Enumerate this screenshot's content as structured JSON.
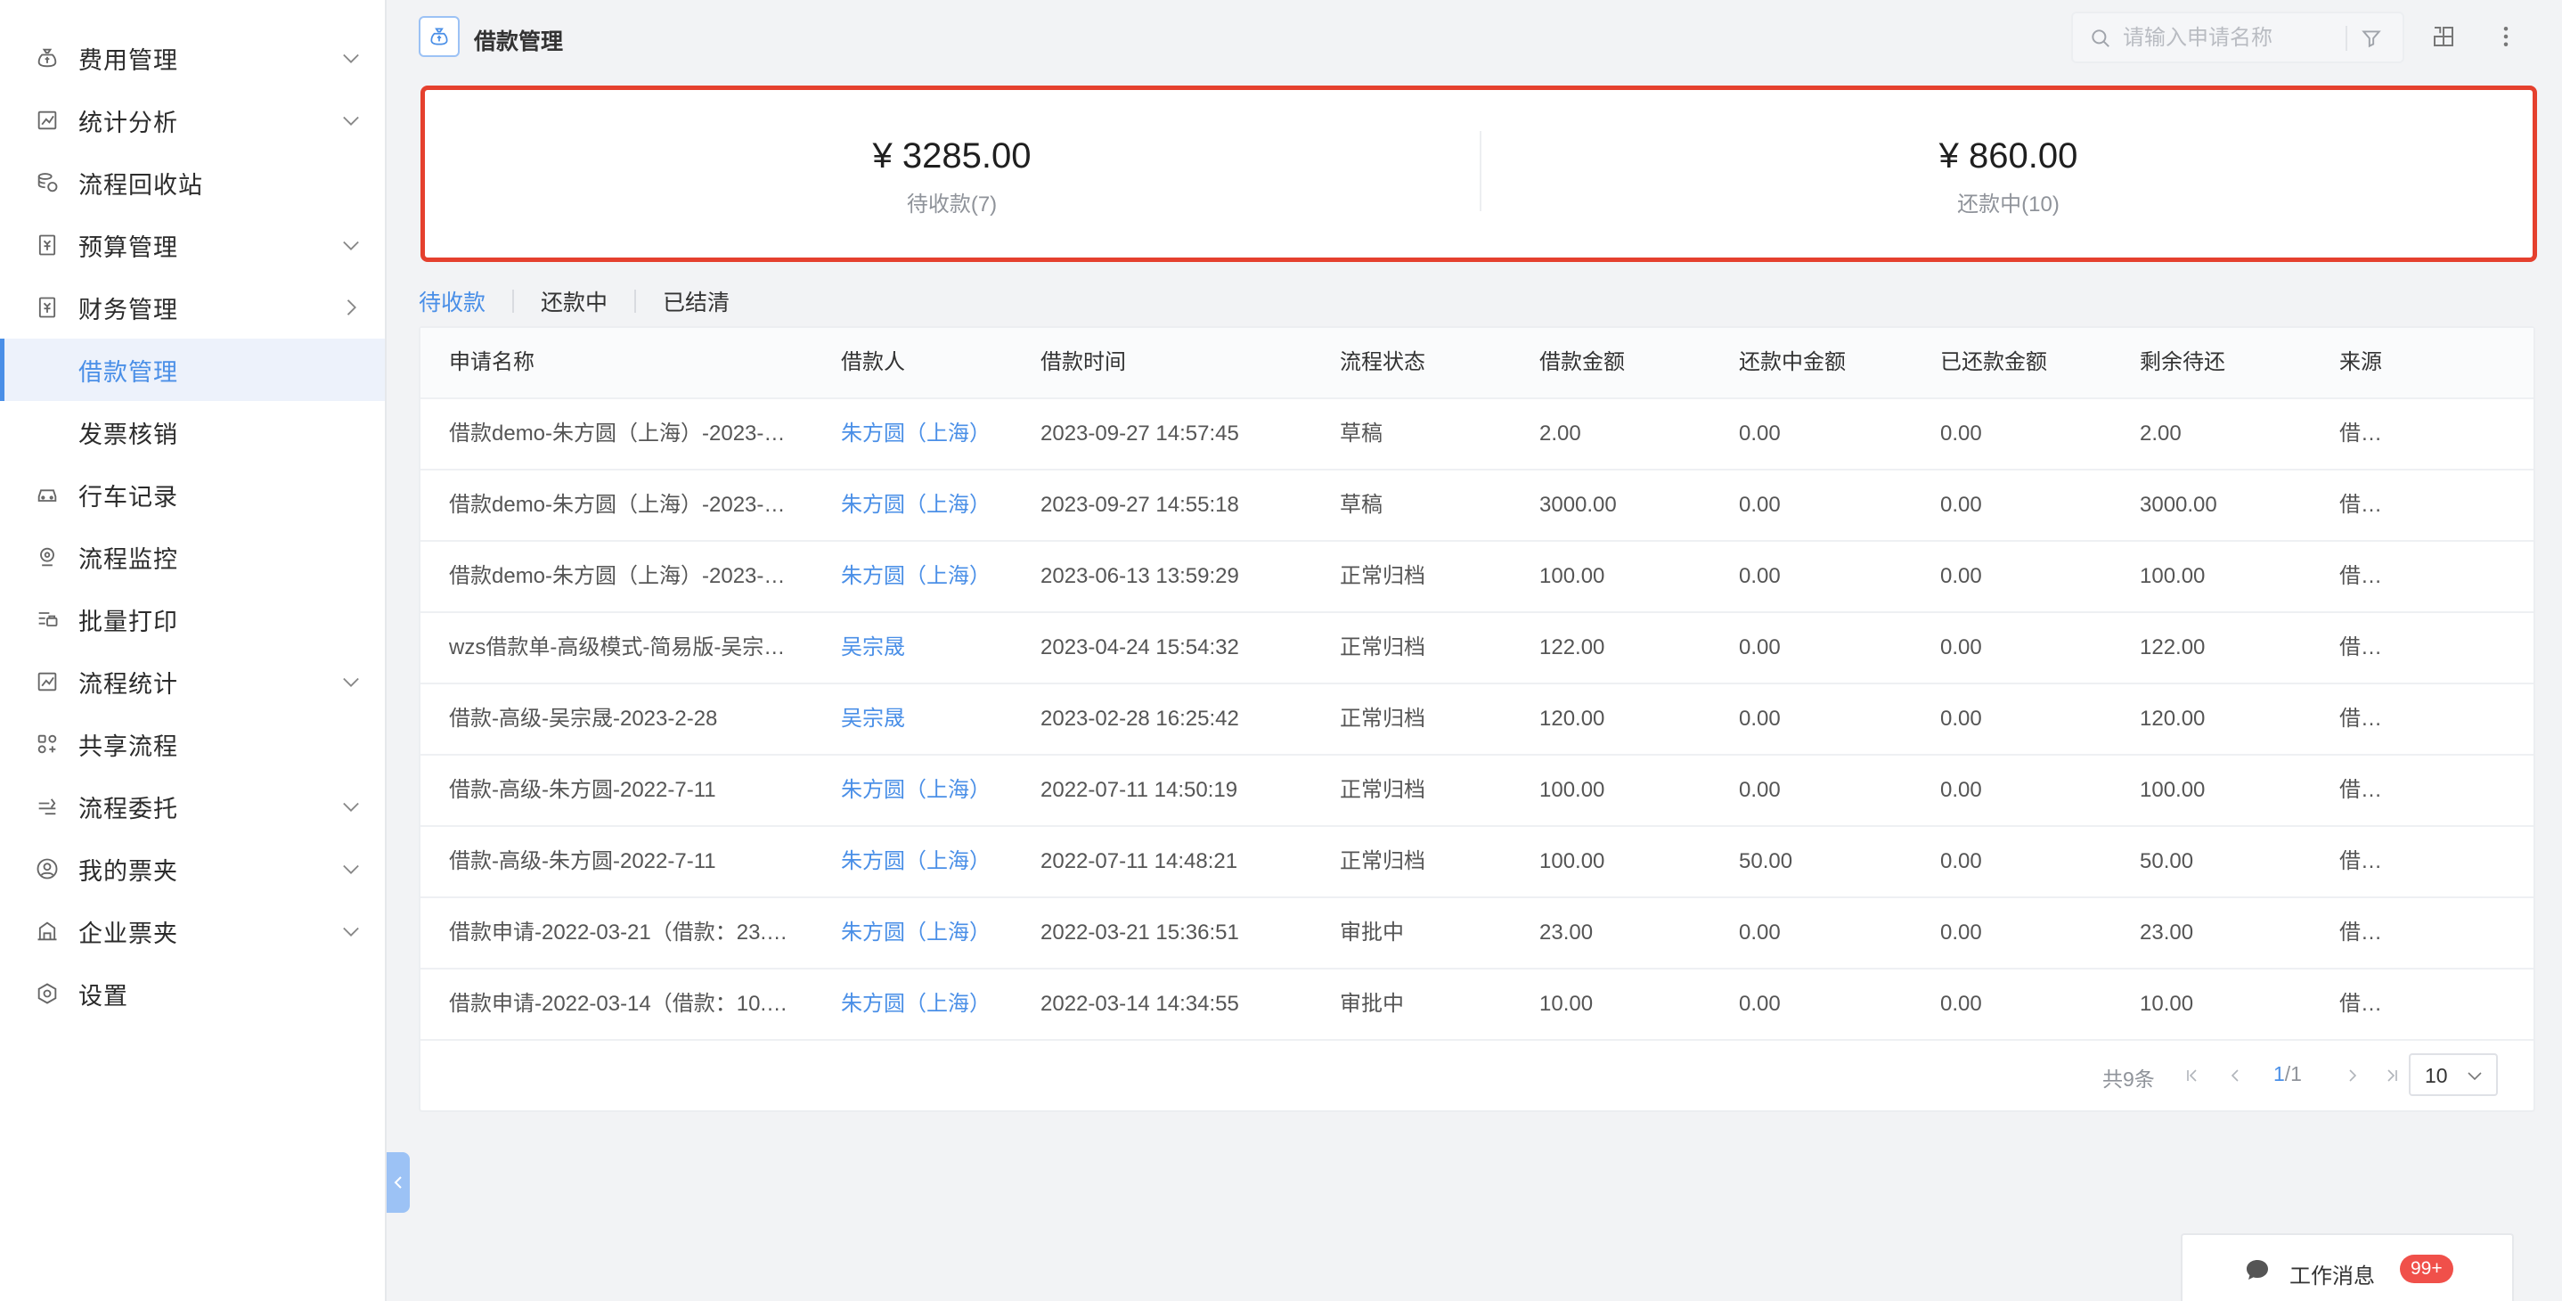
{
  "sidebar": {
    "items": [
      {
        "label": "费用管理",
        "icon": "money-bag-icon"
      },
      {
        "label": "统计分析",
        "icon": "chart-icon"
      },
      {
        "label": "流程回收站",
        "icon": "recycle-icon"
      },
      {
        "label": "预算管理",
        "icon": "budget-icon"
      },
      {
        "label": "财务管理",
        "icon": "finance-icon"
      },
      {
        "label": "借款管理"
      },
      {
        "label": "发票核销"
      },
      {
        "label": "行车记录",
        "icon": "car-icon"
      },
      {
        "label": "流程监控",
        "icon": "monitor-icon"
      },
      {
        "label": "批量打印",
        "icon": "print-icon"
      },
      {
        "label": "流程统计",
        "icon": "stats-icon"
      },
      {
        "label": "共享流程",
        "icon": "share-icon"
      },
      {
        "label": "流程委托",
        "icon": "delegate-icon"
      },
      {
        "label": "我的票夹",
        "icon": "user-icon"
      },
      {
        "label": "企业票夹",
        "icon": "enterprise-icon"
      },
      {
        "label": "设置",
        "icon": "settings-icon"
      }
    ]
  },
  "header": {
    "title": "借款管理",
    "search_placeholder": "请输入申请名称"
  },
  "summary": {
    "pending_amount": "¥ 3285.00",
    "pending_label": "待收款(7)",
    "repaying_amount": "¥ 860.00",
    "repaying_label": "还款中(10)"
  },
  "tabs": [
    "待收款",
    "还款中",
    "已结清"
  ],
  "table": {
    "columns": [
      "申请名称",
      "借款人",
      "借款时间",
      "流程状态",
      "借款金额",
      "还款中金额",
      "已还款金额",
      "剩余待还",
      "来源"
    ],
    "rows": [
      [
        "借款demo-朱方圆（上海）-2023-…",
        "朱方圆（上海）",
        "2023-09-27 14:57:45",
        "草稿",
        "2.00",
        "0.00",
        "0.00",
        "2.00",
        "借…"
      ],
      [
        "借款demo-朱方圆（上海）-2023-…",
        "朱方圆（上海）",
        "2023-09-27 14:55:18",
        "草稿",
        "3000.00",
        "0.00",
        "0.00",
        "3000.00",
        "借…"
      ],
      [
        "借款demo-朱方圆（上海）-2023-…",
        "朱方圆（上海）",
        "2023-06-13 13:59:29",
        "正常归档",
        "100.00",
        "0.00",
        "0.00",
        "100.00",
        "借…"
      ],
      [
        "wzs借款单-高级模式-简易版-吴宗…",
        "吴宗晟",
        "2023-04-24 15:54:32",
        "正常归档",
        "122.00",
        "0.00",
        "0.00",
        "122.00",
        "借…"
      ],
      [
        "借款-高级-吴宗晟-2023-2-28",
        "吴宗晟",
        "2023-02-28 16:25:42",
        "正常归档",
        "120.00",
        "0.00",
        "0.00",
        "120.00",
        "借…"
      ],
      [
        "借款-高级-朱方圆-2022-7-11",
        "朱方圆（上海）",
        "2022-07-11 14:50:19",
        "正常归档",
        "100.00",
        "0.00",
        "0.00",
        "100.00",
        "借…"
      ],
      [
        "借款-高级-朱方圆-2022-7-11",
        "朱方圆（上海）",
        "2022-07-11 14:48:21",
        "正常归档",
        "100.00",
        "50.00",
        "0.00",
        "50.00",
        "借…"
      ],
      [
        "借款申请-2022-03-21（借款：23.…",
        "朱方圆（上海）",
        "2022-03-21 15:36:51",
        "审批中",
        "23.00",
        "0.00",
        "0.00",
        "23.00",
        "借…"
      ],
      [
        "借款申请-2022-03-14（借款：10.…",
        "朱方圆（上海）",
        "2022-03-14 14:34:55",
        "审批中",
        "10.00",
        "0.00",
        "0.00",
        "10.00",
        "借…"
      ]
    ]
  },
  "pager": {
    "total": "共9条",
    "current": "1",
    "pages": "/1",
    "page_size": "10"
  },
  "messages": {
    "label": "工作消息",
    "badge": "99+"
  },
  "colors": {
    "accent": "#4a8fe7",
    "highlight_border": "#e5402e",
    "badge": "#f0504a"
  }
}
